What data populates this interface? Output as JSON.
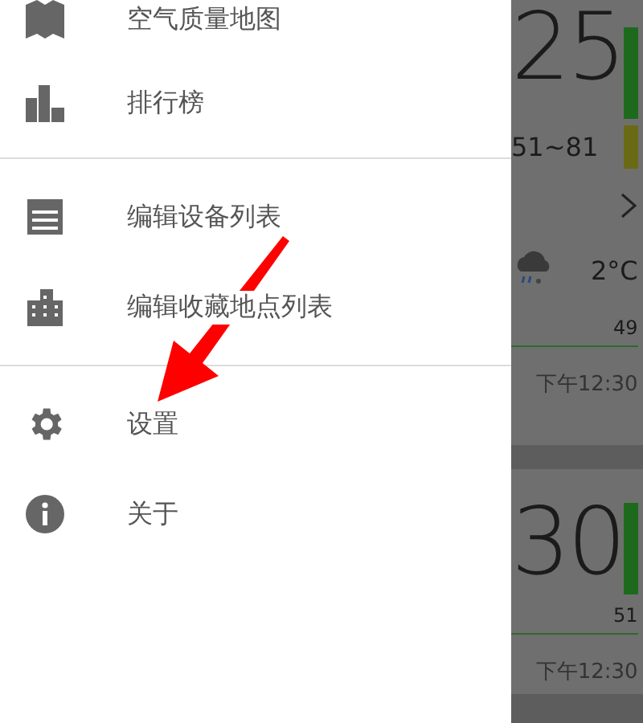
{
  "drawer": {
    "sections": [
      {
        "items": [
          {
            "kind": "map",
            "label": "空气质量地图"
          },
          {
            "kind": "chart",
            "label": "排行榜"
          }
        ]
      },
      {
        "items": [
          {
            "kind": "list",
            "label": "编辑设备列表"
          },
          {
            "kind": "building",
            "label": "编辑收藏地点列表"
          }
        ]
      },
      {
        "items": [
          {
            "kind": "gear",
            "label": "设置"
          },
          {
            "kind": "info",
            "label": "关于"
          }
        ]
      }
    ]
  },
  "cards": [
    {
      "value": "25",
      "range": "51~81",
      "bars": [
        {
          "color": "#1d6a1d"
        },
        {
          "color": "#6b6a14"
        }
      ],
      "weather": {
        "temperature": "2°C"
      },
      "reading": "49",
      "time": "下午12:30"
    },
    {
      "value": "30",
      "bars": [
        {
          "color": "#1d6a1d"
        }
      ],
      "reading": "51",
      "time": "下午12:30"
    }
  ]
}
